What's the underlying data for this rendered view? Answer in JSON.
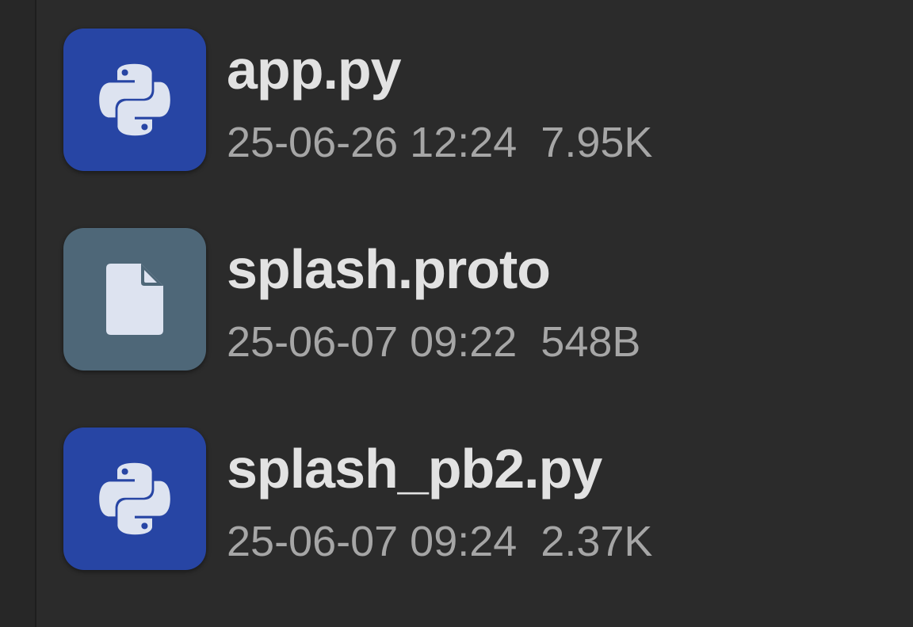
{
  "colors": {
    "background": "#2b2b2b",
    "python_icon_bg": "#2745a4",
    "generic_icon_bg": "#4e6778",
    "icon_glyph": "#dde3f0",
    "filename_text": "#e2e2e2",
    "meta_text": "#a6a6a6"
  },
  "files": [
    {
      "name": "app.py",
      "date": "25-06-26 12:24",
      "size": "7.95K",
      "icon": "python-file-icon"
    },
    {
      "name": "splash.proto",
      "date": "25-06-07 09:22",
      "size": "548B",
      "icon": "generic-file-icon"
    },
    {
      "name": "splash_pb2.py",
      "date": "25-06-07 09:24",
      "size": "2.37K",
      "icon": "python-file-icon"
    }
  ]
}
